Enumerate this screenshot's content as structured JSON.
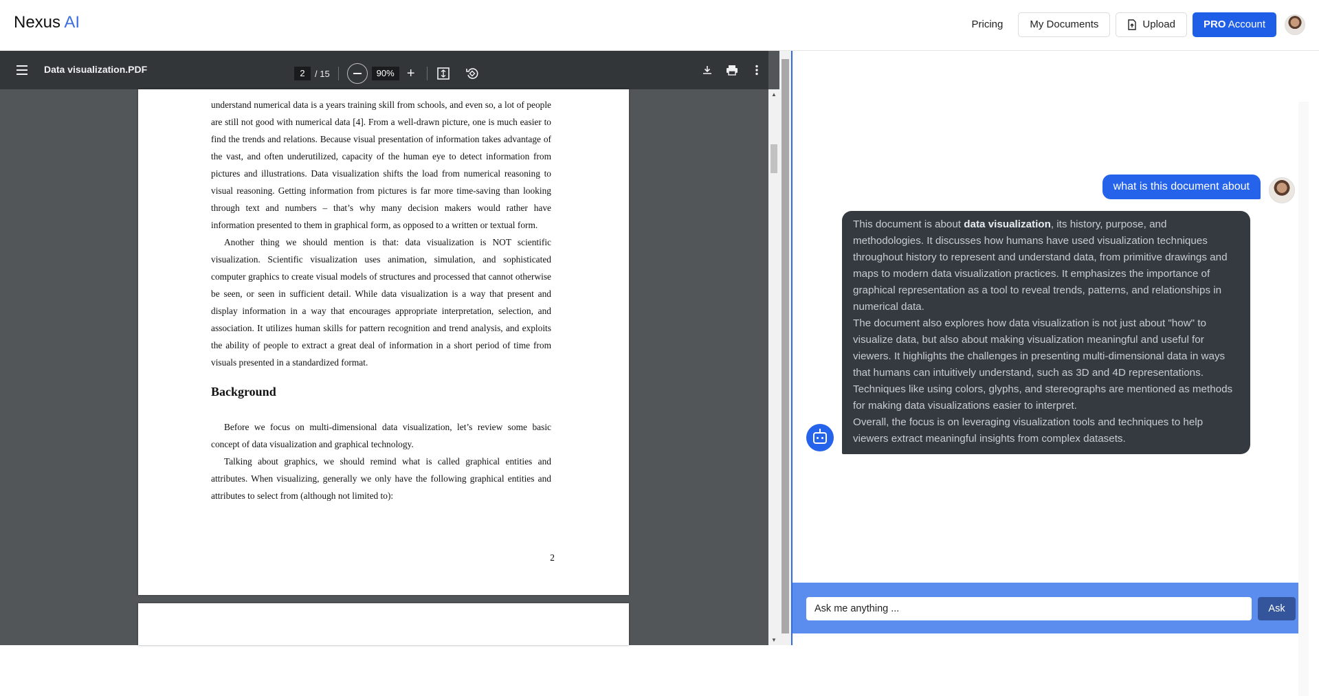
{
  "header": {
    "logo_main": "Nexus",
    "logo_accent": "AI",
    "nav": {
      "pricing": "Pricing",
      "my_documents": "My Documents",
      "upload": "Upload",
      "pro_bold": "PRO",
      "pro_rest": "Account"
    }
  },
  "pdf": {
    "title": "Data visualization.PDF",
    "current_page": "2",
    "total_pages": "/ 15",
    "zoom": "90%",
    "paragraphs": [
      "understand numerical data is a years training skill from schools, and even so, a lot of people are still not good with numerical data [4]. From a well-drawn picture, one is much easier to find the trends and relations. Because visual presentation of information takes advantage of the vast, and often underutilized, capacity of the human eye to detect information from pictures and illustrations. Data visualization shifts the load from numerical reasoning to visual reasoning. Getting information from pictures is far more time-saving than looking through text and numbers – that’s why many decision makers would rather have information presented to them in graphical form, as opposed to a written or textual form.",
      "Another thing we should mention is that: data visualization is NOT scientific visualization. Scientific visualization uses animation, simulation, and sophisticated computer graphics to create visual models of structures and processed that cannot otherwise be seen, or seen in sufficient detail. While data visualization is a way that present and display information in a way that encourages appropriate interpretation, selection, and association. It utilizes human skills for pattern recognition and trend analysis, and exploits the ability of people to extract a great deal of information in a short period of time from visuals presented in a standardized format.",
      "Background",
      "Before we focus on multi-dimensional data visualization, let’s review some basic concept of data visualization and graphical technology.",
      "Talking about graphics, we should remind what is called graphical entities and attributes. When visualizing, generally we only have the following graphical entities and attributes to select from (although not limited to):"
    ],
    "page_number": "2"
  },
  "chat": {
    "user_message": "what is this document about",
    "bot_intro": "This document is about ",
    "bot_bold": "data visualization",
    "bot_p1_rest": ", its history, purpose, and methodologies. It discusses how humans have used visualization techniques throughout history to represent and understand data, from primitive drawings and maps to modern data visualization practices. It emphasizes the importance of graphical representation as a tool to reveal trends, patterns, and relationships in numerical data.",
    "bot_p2": "The document also explores how data visualization is not just about \"how\" to visualize data, but also about making visualization meaningful and useful for viewers. It highlights the challenges in presenting multi-dimensional data in ways that humans can intuitively understand, such as 3D and 4D representations. Techniques like using colors, glyphs, and stereographs are mentioned as methods for making data visualizations easier to interpret.",
    "bot_p3": "Overall, the focus is on leveraging visualization tools and techniques to help viewers extract meaningful insights from complex datasets.",
    "input_placeholder": "Ask me anything ...",
    "ask_label": "Ask"
  },
  "colors": {
    "accent": "#2563eb",
    "pdf_toolbar": "#323639",
    "pdf_bg": "#525659",
    "bot_bubble": "#343a40",
    "input_bar": "#5b8def"
  }
}
